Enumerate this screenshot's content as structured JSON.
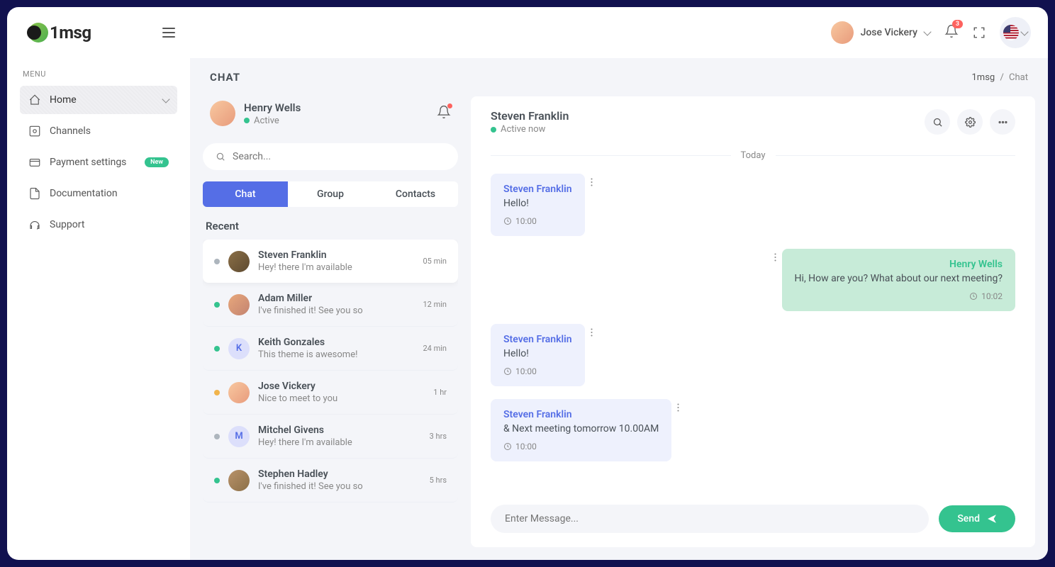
{
  "brand": "1msg",
  "user": {
    "name": "Jose Vickery"
  },
  "notification_count": "3",
  "sidebar": {
    "menu_label": "MENU",
    "items": [
      {
        "label": "Home"
      },
      {
        "label": "Channels"
      },
      {
        "label": "Payment settings",
        "badge": "New"
      },
      {
        "label": "Documentation"
      },
      {
        "label": "Support"
      }
    ]
  },
  "page": {
    "title": "CHAT",
    "breadcrumb_root": "1msg",
    "breadcrumb_current": "Chat"
  },
  "me": {
    "name": "Henry Wells",
    "status": "Active"
  },
  "search_placeholder": "Search...",
  "tabs": {
    "chat": "Chat",
    "group": "Group",
    "contacts": "Contacts"
  },
  "recent_label": "Recent",
  "conversations": [
    {
      "name": "Steven Franklin",
      "preview": "Hey! there I'm available",
      "time": "05 min",
      "status": "gray"
    },
    {
      "name": "Adam Miller",
      "preview": "I've finished it! See you so",
      "time": "12 min",
      "status": "green"
    },
    {
      "name": "Keith Gonzales",
      "preview": "This theme is awesome!",
      "time": "24 min",
      "status": "green",
      "initial": "K"
    },
    {
      "name": "Jose Vickery",
      "preview": "Nice to meet to you",
      "time": "1 hr",
      "status": "orange"
    },
    {
      "name": "Mitchel Givens",
      "preview": "Hey! there I'm available",
      "time": "3 hrs",
      "status": "gray",
      "initial": "M"
    },
    {
      "name": "Stephen Hadley",
      "preview": "I've finished it! See you so",
      "time": "5 hrs",
      "status": "green"
    }
  ],
  "active_chat": {
    "name": "Steven Franklin",
    "status": "Active now",
    "day_label": "Today",
    "messages": [
      {
        "sender": "Steven Franklin",
        "text": "Hello!",
        "time": "10:00",
        "mine": false
      },
      {
        "sender": "Henry Wells",
        "text": "Hi, How are you? What about our next meeting?",
        "time": "10:02",
        "mine": true
      },
      {
        "sender": "Steven Franklin",
        "text": "Hello!",
        "time": "10:00",
        "mine": false
      },
      {
        "sender": "Steven Franklin",
        "text": "& Next meeting tomorrow 10.00AM",
        "time": "10:00",
        "mine": false
      }
    ]
  },
  "composer": {
    "placeholder": "Enter Message...",
    "send_label": "Send"
  }
}
